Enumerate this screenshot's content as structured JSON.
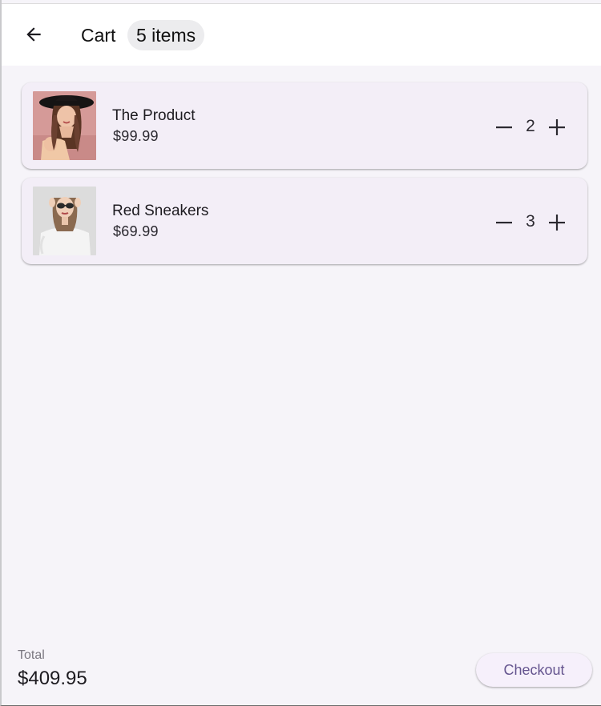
{
  "header": {
    "back_icon": "arrow-left-icon",
    "title": "Cart",
    "item_count": "5 items"
  },
  "cart": {
    "items": [
      {
        "name": "The Product",
        "price": "$99.99",
        "quantity": "2",
        "image": "woman-in-black-hat-photo"
      },
      {
        "name": "Red Sneakers",
        "price": "$69.99",
        "quantity": "3",
        "image": "woman-in-sunglasses-white-sweater-photo"
      }
    ]
  },
  "footer": {
    "total_label": "Total",
    "total_value": "$409.95",
    "checkout_label": "Checkout"
  },
  "colors": {
    "background": "#f6f4f9",
    "card": "#f3eef7",
    "accent": "#65558f"
  }
}
